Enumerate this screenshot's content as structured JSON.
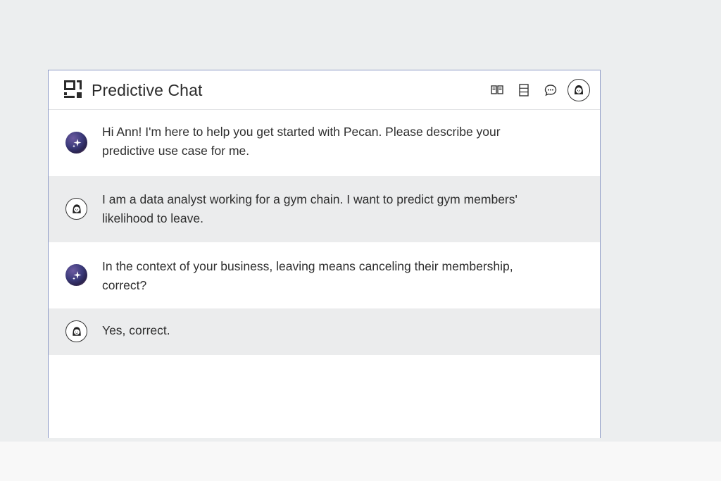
{
  "header": {
    "title": "Predictive Chat",
    "icons": [
      "book-icon",
      "list-icon",
      "chat-bubble-icon",
      "user-avatar"
    ]
  },
  "messages": [
    {
      "role": "assistant",
      "text": "Hi Ann! I'm here to help you get started with Pecan. Please describe your predictive use case for me."
    },
    {
      "role": "user",
      "text": "I am a data analyst working for a gym chain. I want to predict gym members' likelihood to leave."
    },
    {
      "role": "assistant",
      "text": "In the context of your business, leaving means canceling their membership, correct?"
    },
    {
      "role": "user",
      "text": "Yes, correct."
    }
  ],
  "colors": {
    "page_background": "#eceeef",
    "window_background": "#ffffff",
    "user_message_background": "#ebeced",
    "window_border": "#8e9bc6",
    "text": "#2e2e2e"
  }
}
